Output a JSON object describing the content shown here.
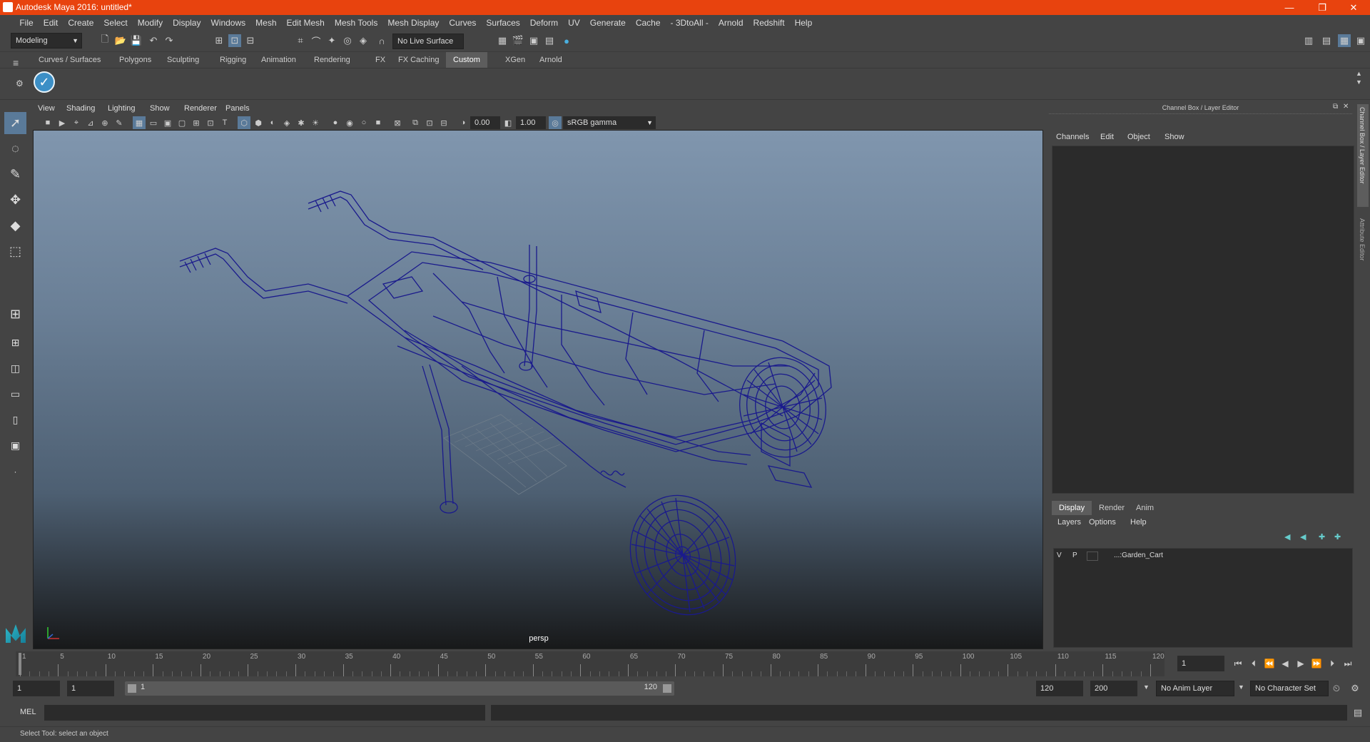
{
  "app": {
    "title": "Autodesk Maya 2016: untitled*"
  },
  "window_controls": {
    "minimize": "—",
    "restore": "❐",
    "close": "✕"
  },
  "menus": [
    "File",
    "Edit",
    "Create",
    "Select",
    "Modify",
    "Display",
    "Windows",
    "Mesh",
    "Edit Mesh",
    "Mesh Tools",
    "Mesh Display",
    "Curves",
    "Surfaces",
    "Deform",
    "UV",
    "Generate",
    "Cache",
    "- 3DtoAll -",
    "Arnold",
    "Redshift",
    "Help"
  ],
  "status_line": {
    "mode_dropdown": "Modeling",
    "live_surface": "No Live Surface"
  },
  "shelf_tabs": [
    "Curves / Surfaces",
    "Polygons",
    "Sculpting",
    "Rigging",
    "Animation",
    "Rendering",
    "FX",
    "FX Caching",
    "Custom",
    "XGen",
    "Arnold"
  ],
  "shelf_active_tab": "Custom",
  "viewport": {
    "menus": [
      "View",
      "Shading",
      "Lighting",
      "Show",
      "Renderer",
      "Panels"
    ],
    "exposure": "0.00",
    "gamma": "1.00",
    "color_space": "sRGB gamma",
    "camera_label": "persp",
    "wire_color": "#1a1a8c"
  },
  "channel_box": {
    "title": "Channel Box / Layer Editor",
    "menus": [
      "Channels",
      "Edit",
      "Object",
      "Show"
    ],
    "side_tabs": [
      "Channel Box / Layer Editor",
      "Attribute Editor"
    ]
  },
  "layer_editor": {
    "tabs": [
      "Display",
      "Render",
      "Anim"
    ],
    "active_tab": "Display",
    "menus": [
      "Layers",
      "Options",
      "Help"
    ],
    "layers": [
      {
        "visible": "V",
        "playback": "P",
        "name": "...:Garden_Cart"
      }
    ]
  },
  "timeline": {
    "ticks": [
      "1",
      "5",
      "10",
      "15",
      "20",
      "25",
      "30",
      "35",
      "40",
      "45",
      "50",
      "55",
      "60",
      "65",
      "70",
      "75",
      "80",
      "85",
      "90",
      "95",
      "100",
      "105",
      "110",
      "115",
      "120"
    ],
    "current_frame": "1"
  },
  "range": {
    "start": "1",
    "playback_start": "1",
    "slider_start": "1",
    "slider_end": "120",
    "playback_end": "120",
    "end": "200",
    "anim_layer": "No Anim Layer",
    "character_set": "No Character Set"
  },
  "command_line": {
    "label": "MEL"
  },
  "help_line": {
    "text": "Select Tool: select an object"
  }
}
